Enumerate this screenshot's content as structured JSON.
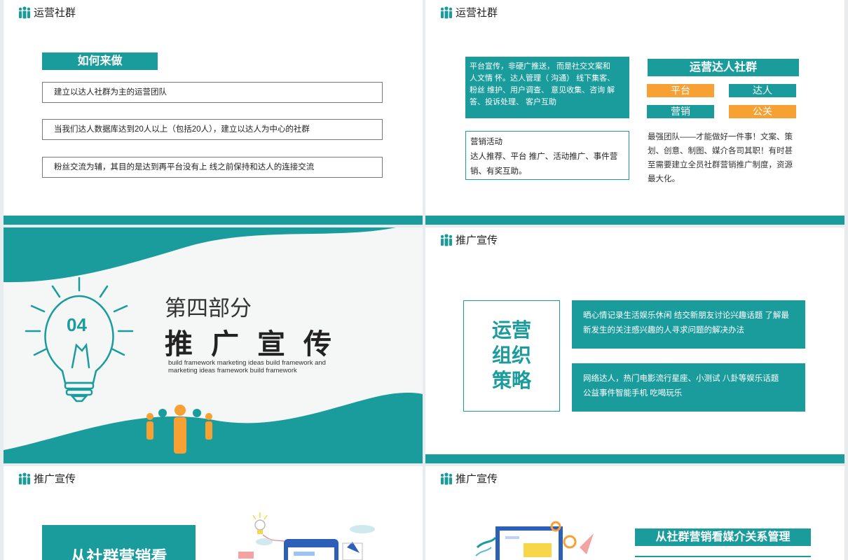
{
  "brand": {
    "teal": "#1a9c9d",
    "orange": "#f7a135"
  },
  "slide1": {
    "title": "运营社群",
    "label": "如何来做",
    "items": [
      "建立以达人社群为主的运营团队",
      "当我们达人数据库达到20人以上（包括20人），建立以达人为中心的社群",
      "粉丝交流为辅，其目的是达到再平台没有上 线之前保持和达人的连接交流"
    ]
  },
  "slide2": {
    "title": "运营社群",
    "teal_lines": [
      "平台宣传，非硬广推送，  而是社交文案和",
      "人文情 怀。达人管理（ 沟通） 线下集客、",
      "粉丝 维护、用户调查、  意见收集、咨询 解",
      "答、投诉处理、  客户互助"
    ],
    "outline_lines": [
      "营销活动",
      "达人推荐、平台 推广、活动推广、事件营",
      "销、有奖互助。"
    ],
    "heading": "运营达人社群",
    "tags": [
      "平台",
      "达人",
      "营销",
      "公关"
    ],
    "desc_lines": [
      "最强团队——才能做好一件事！文案、策",
      "划、创意、制图、媒介各司其职！有时甚",
      "至需要建立全员社群营销推广制度，资源",
      "最大化。"
    ]
  },
  "slide3": {
    "number": "04",
    "part": "第四部分",
    "title": "推广宣传",
    "subtitle": "build framework marketing ideas build framework and marketing ideas framework  build framework"
  },
  "slide4": {
    "title": "推广宣传",
    "frame_lines": [
      "运营",
      "组织",
      "策略"
    ],
    "box1_lines": [
      "晒心情记录生活娱乐休闲 结交新朋友讨论兴趣话题 了解最",
      "新发生的关注感兴趣的人寻求问题的解决办法"
    ],
    "box2_lines": [
      "网络达人，热门电影流行星座、小测试  八卦等娱乐话题",
      "公益事件智能手机 吃喝玩乐"
    ]
  },
  "slide5": {
    "title": "推广宣传",
    "block": "从社群营销看"
  },
  "slide6": {
    "title": "推广宣传",
    "heading": "从社群营销看媒介关系管理"
  }
}
